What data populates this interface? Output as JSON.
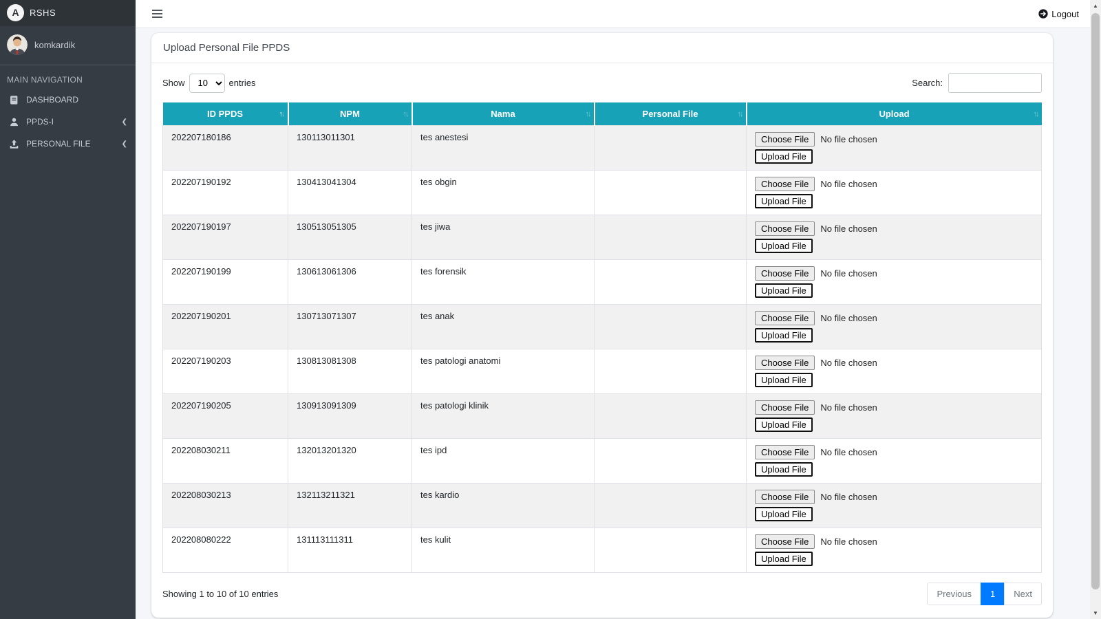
{
  "app": {
    "brand": "RSHS",
    "user": "komkardik",
    "logout_label": "Logout",
    "nav_header": "MAIN NAVIGATION",
    "nav_items": [
      {
        "label": "DASHBOARD",
        "icon": "book-icon",
        "expandable": false
      },
      {
        "label": "PPDS-I",
        "icon": "user-icon",
        "expandable": true
      },
      {
        "label": "PERSONAL FILE",
        "icon": "upload-icon",
        "expandable": true
      }
    ]
  },
  "icons": {
    "logout": "sign-out-circle-icon",
    "menu": "hamburger-icon",
    "sort_asc": "↑",
    "sort_desc": "↓",
    "chevron": "❮",
    "scroll_up": "▲",
    "scroll_down": "▼"
  },
  "page": {
    "title": "Upload Personal File PPDS",
    "show_label": "Show",
    "entries_label": "entries",
    "page_length": "10",
    "search_label": "Search:",
    "search_value": "",
    "info_text": "Showing 1 to 10 of 10 entries",
    "pagination": {
      "previous": "Previous",
      "page": "1",
      "next": "Next"
    }
  },
  "table": {
    "columns": [
      "ID PPDS",
      "NPM",
      "Nama",
      "Personal File",
      "Upload"
    ],
    "sorted_column": "ID PPDS",
    "sorted_direction": "asc",
    "choose_file_label": "Choose File",
    "no_file_label": "No file chosen",
    "upload_file_label": "Upload File",
    "rows": [
      {
        "id": "202207180186",
        "npm": "130113011301",
        "nama": "tes anestesi",
        "personal_file": ""
      },
      {
        "id": "202207190192",
        "npm": "130413041304",
        "nama": "tes obgin",
        "personal_file": ""
      },
      {
        "id": "202207190197",
        "npm": "130513051305",
        "nama": "tes jiwa",
        "personal_file": ""
      },
      {
        "id": "202207190199",
        "npm": "130613061306",
        "nama": "tes forensik",
        "personal_file": ""
      },
      {
        "id": "202207190201",
        "npm": "130713071307",
        "nama": "tes anak",
        "personal_file": ""
      },
      {
        "id": "202207190203",
        "npm": "130813081308",
        "nama": "tes patologi anatomi",
        "personal_file": ""
      },
      {
        "id": "202207190205",
        "npm": "130913091309",
        "nama": "tes patologi klinik",
        "personal_file": ""
      },
      {
        "id": "202208030211",
        "npm": "132013201320",
        "nama": "tes ipd",
        "personal_file": ""
      },
      {
        "id": "202208030213",
        "npm": "132113211321",
        "nama": "tes kardio",
        "personal_file": ""
      },
      {
        "id": "202208080222",
        "npm": "131113111311",
        "nama": "tes kulit",
        "personal_file": ""
      }
    ]
  },
  "colors": {
    "table_header_teal": "#17a2b8",
    "sidebar_dark": "#363c43",
    "active_page_blue": "#007bff",
    "content_bg": "#f4f6f9",
    "stripe_gray": "#f1f1f1"
  }
}
